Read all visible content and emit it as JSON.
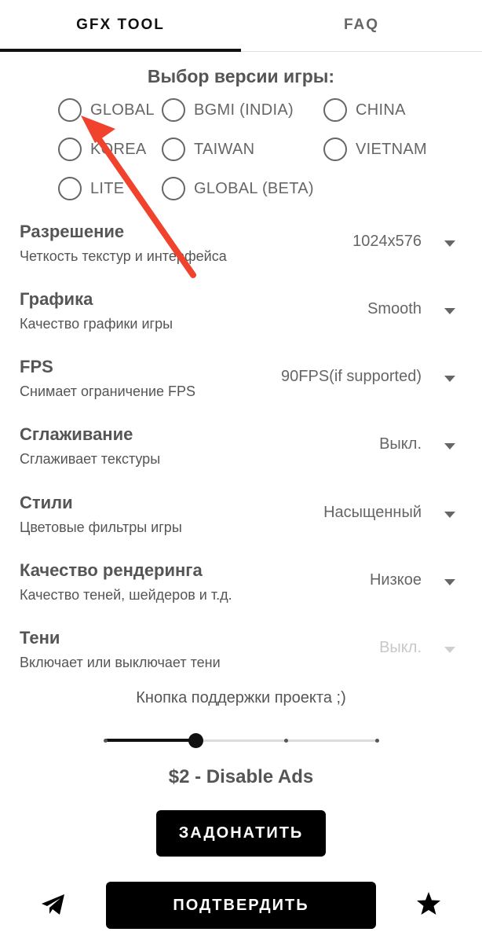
{
  "tabs": [
    {
      "label": "GFX TOOL",
      "active": true
    },
    {
      "label": "FAQ",
      "active": false
    }
  ],
  "version_section": {
    "title": "Выбор версии игры:",
    "options": [
      {
        "label": "GLOBAL",
        "selected": false
      },
      {
        "label": "BGMI (INDIA)",
        "selected": false
      },
      {
        "label": "CHINA",
        "selected": false
      },
      {
        "label": "KOREA",
        "selected": false
      },
      {
        "label": "TAIWAN",
        "selected": false
      },
      {
        "label": "VIETNAM",
        "selected": false
      },
      {
        "label": "LITE",
        "selected": false
      },
      {
        "label": "GLOBAL (BETA)",
        "selected": false
      }
    ]
  },
  "settings": [
    {
      "title": "Разрешение",
      "subtitle": "Четкость текстур и интерфейса",
      "value": "1024x576",
      "enabled": true
    },
    {
      "title": "Графика",
      "subtitle": "Качество графики игры",
      "value": "Smooth",
      "enabled": true
    },
    {
      "title": "FPS",
      "subtitle": "Снимает ограничение FPS",
      "value": "90FPS(if supported)",
      "enabled": true
    },
    {
      "title": "Сглаживание",
      "subtitle": "Сглаживает текстуры",
      "value": "Выкл.",
      "enabled": true
    },
    {
      "title": "Стили",
      "subtitle": "Цветовые фильтры игры",
      "value": "Насыщенный",
      "enabled": true
    },
    {
      "title": "Качество рендеринга",
      "subtitle": "Качество теней, шейдеров и т.д.",
      "value": "Низкое",
      "enabled": true
    },
    {
      "title": "Тени",
      "subtitle": "Включает или выключает тени",
      "value": "Выкл.",
      "enabled": false
    }
  ],
  "support": {
    "text": "Кнопка поддержки проекта ;)",
    "slider_steps": 4,
    "slider_step_index": 1,
    "price_label": "$2 - Disable Ads",
    "donate_label": "ЗАДОНАТИТЬ"
  },
  "footer": {
    "confirm_label": "ПОДТВЕРДИТЬ",
    "left_icon": "telegram-icon",
    "right_icon": "star-icon"
  },
  "colors": {
    "annotation_arrow": "#f0422c",
    "text": "#555555",
    "button_background": "#000000"
  }
}
